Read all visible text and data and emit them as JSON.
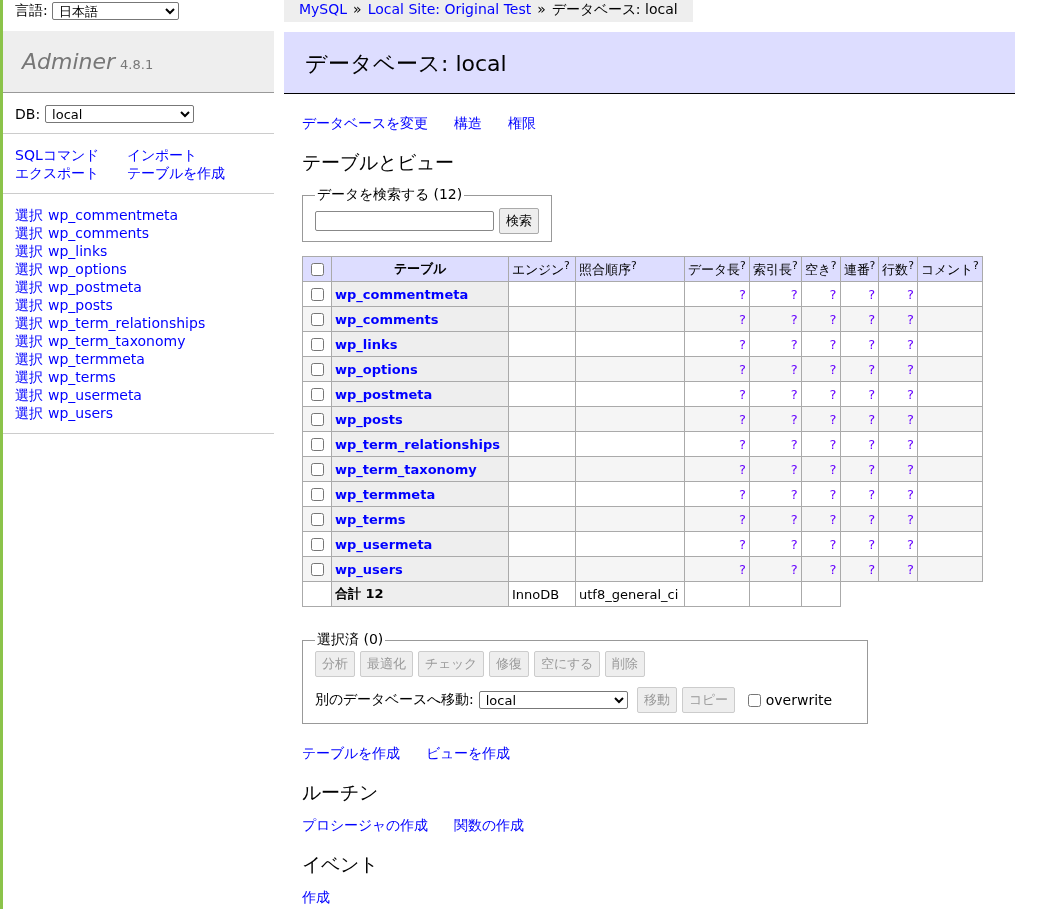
{
  "language": {
    "label": "言語:",
    "value": "日本語"
  },
  "brand": {
    "name": "Adminer",
    "version": "4.8.1"
  },
  "db": {
    "label": "DB:",
    "value": "local"
  },
  "sidebar_links": [
    "SQLコマンド",
    "インポート",
    "エクスポート",
    "テーブルを作成"
  ],
  "sidebar_tables": [
    {
      "action": "選択",
      "name": "wp_commentmeta"
    },
    {
      "action": "選択",
      "name": "wp_comments"
    },
    {
      "action": "選択",
      "name": "wp_links"
    },
    {
      "action": "選択",
      "name": "wp_options"
    },
    {
      "action": "選択",
      "name": "wp_postmeta"
    },
    {
      "action": "選択",
      "name": "wp_posts"
    },
    {
      "action": "選択",
      "name": "wp_term_relationships"
    },
    {
      "action": "選択",
      "name": "wp_term_taxonomy"
    },
    {
      "action": "選択",
      "name": "wp_termmeta"
    },
    {
      "action": "選択",
      "name": "wp_terms"
    },
    {
      "action": "選択",
      "name": "wp_usermeta"
    },
    {
      "action": "選択",
      "name": "wp_users"
    }
  ],
  "breadcrumb": {
    "separator": "»",
    "items": [
      {
        "text": "MySQL",
        "kind": "link"
      },
      {
        "text": "Local Site: Original Test",
        "kind": "link"
      },
      {
        "text": "データベース: local",
        "kind": "text"
      }
    ]
  },
  "title": "データベース: local",
  "top_links": [
    "データベースを変更",
    "構造",
    "権限"
  ],
  "tables_heading": "テーブルとビュー",
  "search": {
    "legend": "データを検索する (12)",
    "button": "検索"
  },
  "table": {
    "all_checked": false,
    "columns": [
      "テーブル",
      "エンジン$^{?}$",
      "照合順序$^{?}$",
      "データ長$^{?}$",
      "索引長$^{?}$",
      "空き$^{?}$",
      "連番$^{?}$",
      "行数$^{?}$",
      "コメント$^{?}$"
    ],
    "rows": [
      {
        "name": "wp_commentmeta",
        "checked": false,
        "values": [
          "?",
          "?",
          "?",
          "?",
          "?"
        ]
      },
      {
        "name": "wp_comments",
        "checked": false,
        "values": [
          "?",
          "?",
          "?",
          "?",
          "?"
        ]
      },
      {
        "name": "wp_links",
        "checked": false,
        "values": [
          "?",
          "?",
          "?",
          "?",
          "?"
        ]
      },
      {
        "name": "wp_options",
        "checked": false,
        "values": [
          "?",
          "?",
          "?",
          "?",
          "?"
        ]
      },
      {
        "name": "wp_postmeta",
        "checked": false,
        "values": [
          "?",
          "?",
          "?",
          "?",
          "?"
        ]
      },
      {
        "name": "wp_posts",
        "checked": false,
        "values": [
          "?",
          "?",
          "?",
          "?",
          "?"
        ]
      },
      {
        "name": "wp_term_relationships",
        "checked": false,
        "values": [
          "?",
          "?",
          "?",
          "?",
          "?"
        ]
      },
      {
        "name": "wp_term_taxonomy",
        "checked": false,
        "values": [
          "?",
          "?",
          "?",
          "?",
          "?"
        ]
      },
      {
        "name": "wp_termmeta",
        "checked": false,
        "values": [
          "?",
          "?",
          "?",
          "?",
          "?"
        ]
      },
      {
        "name": "wp_terms",
        "checked": false,
        "values": [
          "?",
          "?",
          "?",
          "?",
          "?"
        ]
      },
      {
        "name": "wp_usermeta",
        "checked": false,
        "values": [
          "?",
          "?",
          "?",
          "?",
          "?"
        ]
      },
      {
        "name": "wp_users",
        "checked": false,
        "values": [
          "?",
          "?",
          "?",
          "?",
          "?"
        ]
      }
    ],
    "total": {
      "label": "合計 12",
      "engine": "InnoDB",
      "collation": "utf8_general_ci"
    }
  },
  "selection": {
    "legend": "選択済 (0)",
    "buttons": [
      {
        "label": "分析",
        "disabled": true
      },
      {
        "label": "最適化",
        "disabled": true
      },
      {
        "label": "チェック",
        "disabled": true
      },
      {
        "label": "修復",
        "disabled": true
      },
      {
        "label": "空にする",
        "disabled": true
      },
      {
        "label": "削除",
        "disabled": true
      }
    ],
    "move_label": "別のデータベースへ移動:",
    "target": "local",
    "move_buttons": [
      {
        "label": "移動",
        "disabled": true
      },
      {
        "label": "コピー",
        "disabled": true
      }
    ],
    "overwrite": {
      "label": "overwrite",
      "checked": false
    }
  },
  "create_links": [
    "テーブルを作成",
    "ビューを作成"
  ],
  "routines": {
    "heading": "ルーチン",
    "links": [
      "プロシージャの作成",
      "関数の作成"
    ]
  },
  "events": {
    "heading": "イベント",
    "links": [
      "作成"
    ]
  }
}
